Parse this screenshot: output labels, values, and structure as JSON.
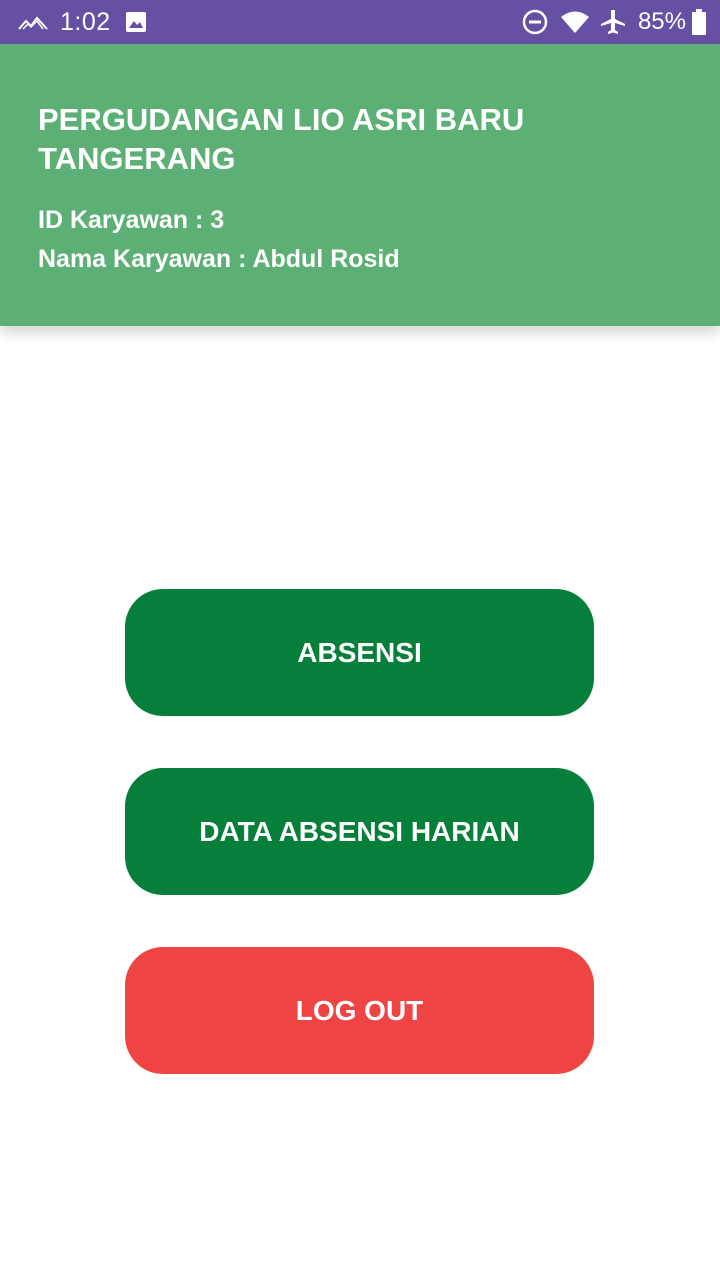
{
  "status_bar": {
    "time": "1:02",
    "battery_text": "85%",
    "icons": [
      "signal-wave-icon",
      "image-icon",
      "do-not-disturb-icon",
      "wifi-icon",
      "airplane-icon",
      "battery-icon"
    ]
  },
  "header": {
    "title": "PERGUDANGAN LIO ASRI BARU TANGERANG",
    "employee_id": "ID Karyawan : 3",
    "employee_name": "Nama Karyawan : Abdul Rosid"
  },
  "buttons": {
    "absensi": "ABSENSI",
    "data_absensi": "DATA ABSENSI HARIAN",
    "logout": "LOG OUT"
  },
  "colors": {
    "status_bar": "#6650a4",
    "header": "#5db075",
    "primary_button": "#067f3b",
    "logout_button": "#ef4444"
  }
}
